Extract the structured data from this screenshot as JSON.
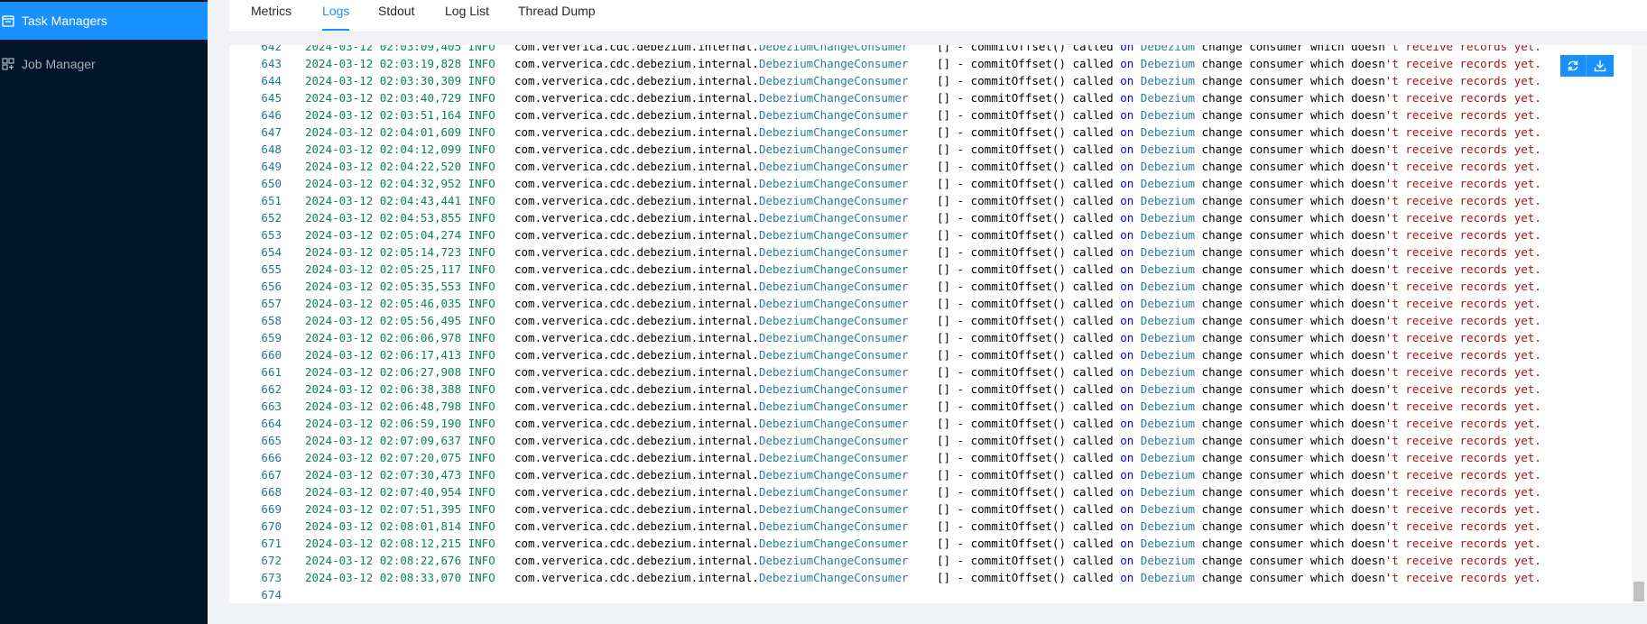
{
  "sidebar": {
    "items": [
      {
        "label": "Task Managers",
        "icon": "task-managers-icon",
        "active": true
      },
      {
        "label": "Job Manager",
        "icon": "job-manager-icon",
        "active": false
      }
    ]
  },
  "tabs": [
    {
      "label": "Metrics"
    },
    {
      "label": "Logs",
      "active": true
    },
    {
      "label": "Stdout"
    },
    {
      "label": "Log List"
    },
    {
      "label": "Thread Dump"
    }
  ],
  "toolbar": {
    "refresh_icon": "refresh-icon",
    "download_icon": "download-icon"
  },
  "log": {
    "lines": [
      {
        "num": "642",
        "time": "2024-03-12 02:03:09,405",
        "level": "INFO"
      },
      {
        "num": "643",
        "time": "2024-03-12 02:03:19,828",
        "level": "INFO"
      },
      {
        "num": "644",
        "time": "2024-03-12 02:03:30,309",
        "level": "INFO"
      },
      {
        "num": "645",
        "time": "2024-03-12 02:03:40,729",
        "level": "INFO"
      },
      {
        "num": "646",
        "time": "2024-03-12 02:03:51,164",
        "level": "INFO"
      },
      {
        "num": "647",
        "time": "2024-03-12 02:04:01,609",
        "level": "INFO"
      },
      {
        "num": "648",
        "time": "2024-03-12 02:04:12,099",
        "level": "INFO"
      },
      {
        "num": "649",
        "time": "2024-03-12 02:04:22,520",
        "level": "INFO"
      },
      {
        "num": "650",
        "time": "2024-03-12 02:04:32,952",
        "level": "INFO"
      },
      {
        "num": "651",
        "time": "2024-03-12 02:04:43,441",
        "level": "INFO"
      },
      {
        "num": "652",
        "time": "2024-03-12 02:04:53,855",
        "level": "INFO"
      },
      {
        "num": "653",
        "time": "2024-03-12 02:05:04,274",
        "level": "INFO"
      },
      {
        "num": "654",
        "time": "2024-03-12 02:05:14,723",
        "level": "INFO"
      },
      {
        "num": "655",
        "time": "2024-03-12 02:05:25,117",
        "level": "INFO"
      },
      {
        "num": "656",
        "time": "2024-03-12 02:05:35,553",
        "level": "INFO"
      },
      {
        "num": "657",
        "time": "2024-03-12 02:05:46,035",
        "level": "INFO"
      },
      {
        "num": "658",
        "time": "2024-03-12 02:05:56,495",
        "level": "INFO"
      },
      {
        "num": "659",
        "time": "2024-03-12 02:06:06,978",
        "level": "INFO"
      },
      {
        "num": "660",
        "time": "2024-03-12 02:06:17,413",
        "level": "INFO"
      },
      {
        "num": "661",
        "time": "2024-03-12 02:06:27,908",
        "level": "INFO"
      },
      {
        "num": "662",
        "time": "2024-03-12 02:06:38,388",
        "level": "INFO"
      },
      {
        "num": "663",
        "time": "2024-03-12 02:06:48,798",
        "level": "INFO"
      },
      {
        "num": "664",
        "time": "2024-03-12 02:06:59,190",
        "level": "INFO"
      },
      {
        "num": "665",
        "time": "2024-03-12 02:07:09,637",
        "level": "INFO"
      },
      {
        "num": "666",
        "time": "2024-03-12 02:07:20,075",
        "level": "INFO"
      },
      {
        "num": "667",
        "time": "2024-03-12 02:07:30,473",
        "level": "INFO"
      },
      {
        "num": "668",
        "time": "2024-03-12 02:07:40,954",
        "level": "INFO"
      },
      {
        "num": "669",
        "time": "2024-03-12 02:07:51,395",
        "level": "INFO"
      },
      {
        "num": "670",
        "time": "2024-03-12 02:08:01,814",
        "level": "INFO"
      },
      {
        "num": "671",
        "time": "2024-03-12 02:08:12,215",
        "level": "INFO"
      },
      {
        "num": "672",
        "time": "2024-03-12 02:08:22,676",
        "level": "INFO"
      },
      {
        "num": "673",
        "time": "2024-03-12 02:08:33,070",
        "level": "INFO"
      },
      {
        "num": "674"
      }
    ],
    "package": "com.ververica.cdc.debezium.internal.",
    "class_name": "DebeziumChangeConsumer",
    "msg_prefix": "[] - commitOffset() called ",
    "msg_kw": "on",
    "msg_space": " ",
    "msg_entity": "Debezium",
    "msg_mid": " change consumer which doesn",
    "msg_str": "'t receive records yet."
  },
  "colors": {
    "sidebar_bg": "#001529",
    "accent": "#1890ff",
    "line_number": "#237893",
    "timestamp": "#098658",
    "class_name": "#267f99",
    "keyword": "#0000ff",
    "string": "#a31515"
  }
}
